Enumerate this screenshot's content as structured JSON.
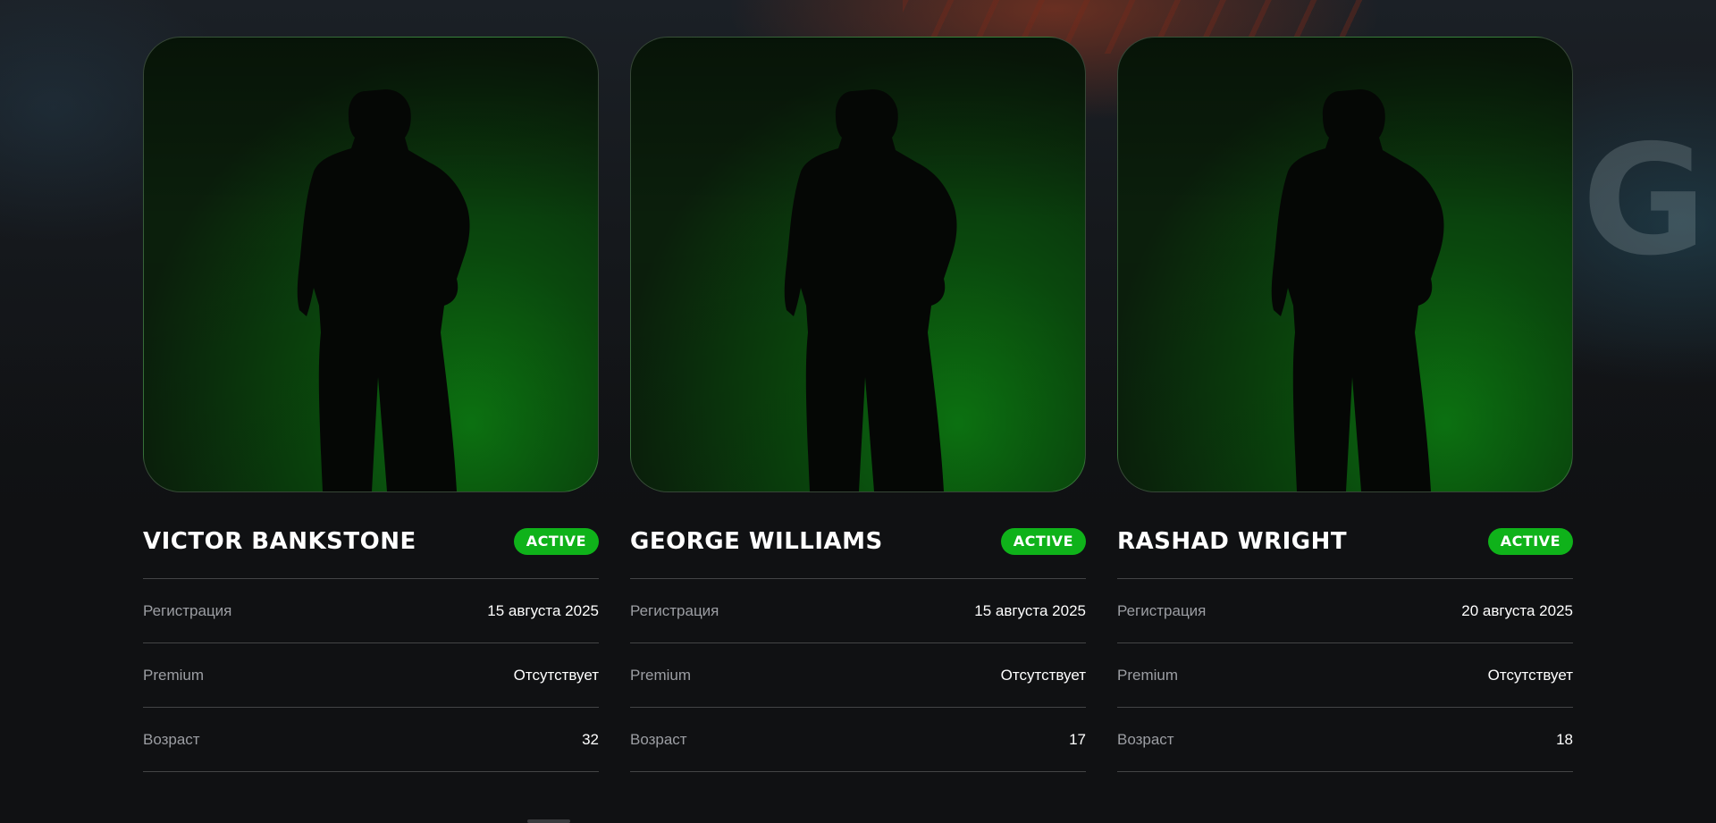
{
  "badge_color": "#0fb21a",
  "players": [
    {
      "name": "VICTOR BANKSTONE",
      "status": "ACTIVE",
      "fields": [
        {
          "label": "Регистрация",
          "value": "15 августа 2025"
        },
        {
          "label": "Premium",
          "value": "Отсутствует"
        },
        {
          "label": "Возраст",
          "value": "32"
        }
      ]
    },
    {
      "name": "GEORGE WILLIAMS",
      "status": "ACTIVE",
      "fields": [
        {
          "label": "Регистрация",
          "value": "15 августа 2025"
        },
        {
          "label": "Premium",
          "value": "Отсутствует"
        },
        {
          "label": "Возраст",
          "value": "17"
        }
      ]
    },
    {
      "name": "RASHAD WRIGHT",
      "status": "ACTIVE",
      "fields": [
        {
          "label": "Регистрация",
          "value": "20 августа 2025"
        },
        {
          "label": "Premium",
          "value": "Отсутствует"
        },
        {
          "label": "Возраст",
          "value": "18"
        }
      ]
    }
  ]
}
